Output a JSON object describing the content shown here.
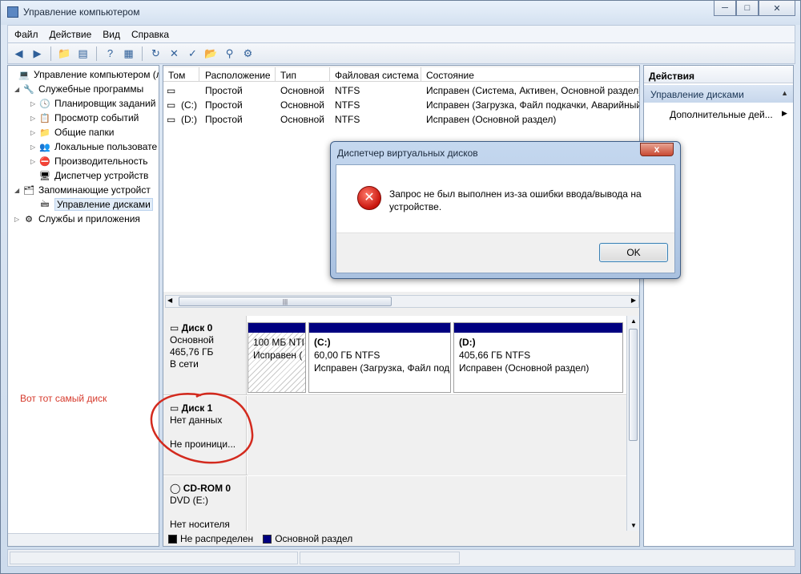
{
  "window": {
    "title": "Управление компьютером"
  },
  "menu": [
    "Файл",
    "Действие",
    "Вид",
    "Справка"
  ],
  "tree": [
    {
      "label": "Управление компьютером (л",
      "icon": "computer-icon"
    },
    {
      "label": "Служебные программы",
      "icon": "tools-icon"
    },
    {
      "label": "Планировщик заданий",
      "icon": "clock-icon"
    },
    {
      "label": "Просмотр событий",
      "icon": "event-viewer-icon"
    },
    {
      "label": "Общие папки",
      "icon": "shared-folder-icon"
    },
    {
      "label": "Локальные пользовате",
      "icon": "users-icon"
    },
    {
      "label": "Производительность",
      "icon": "performance-icon"
    },
    {
      "label": "Диспетчер устройств",
      "icon": "device-manager-icon"
    },
    {
      "label": "Запоминающие устройст",
      "icon": "storage-icon"
    },
    {
      "label": "Управление дисками",
      "icon": "disk-management-icon"
    },
    {
      "label": "Службы и приложения",
      "icon": "services-icon"
    }
  ],
  "volumes": {
    "headers": [
      "Том",
      "Расположение",
      "Тип",
      "Файловая система",
      "Состояние"
    ],
    "rows": [
      {
        "tom": "",
        "loc": "Простой",
        "type": "Основной",
        "fs": "NTFS",
        "state": "Исправен (Система, Активен, Основной раздел)"
      },
      {
        "tom": "(C:)",
        "loc": "Простой",
        "type": "Основной",
        "fs": "NTFS",
        "state": "Исправен (Загрузка, Файл подкачки, Аварийный"
      },
      {
        "tom": "(D:)",
        "loc": "Простой",
        "type": "Основной",
        "fs": "NTFS",
        "state": "Исправен (Основной раздел)"
      }
    ]
  },
  "disks": {
    "disk0": {
      "name": "Диск 0",
      "type": "Основной",
      "size": "465,76 ГБ",
      "status": "В сети"
    },
    "disk0_parts": [
      {
        "line1": "100 МБ NTI",
        "line2": "Исправен ("
      },
      {
        "letter": "(C:)",
        "line1": "60,00 ГБ NTFS",
        "line2": "Исправен (Загрузка, Файл под"
      },
      {
        "letter": "(D:)",
        "line1": "405,66 ГБ NTFS",
        "line2": "Исправен (Основной раздел)"
      }
    ],
    "disk1": {
      "name": "Диск 1",
      "type": "Нет данных",
      "status": "Не проиници..."
    },
    "cdrom": {
      "name": "CD-ROM 0",
      "drive": "DVD (E:)",
      "status": "Нет носителя"
    }
  },
  "legend": [
    "Не распределен",
    "Основной раздел"
  ],
  "legend_colors": [
    "#000000",
    "#000080"
  ],
  "actions": {
    "title": "Действия",
    "section": "Управление дисками",
    "item": "Дополнительные дей..."
  },
  "annotation": "Вот тот самый диск",
  "dialog": {
    "title": "Диспетчер виртуальных дисков",
    "close": "x",
    "message": "Запрос не был выполнен из-за ошибки ввода/вывода на устройстве.",
    "ok": "OK"
  }
}
